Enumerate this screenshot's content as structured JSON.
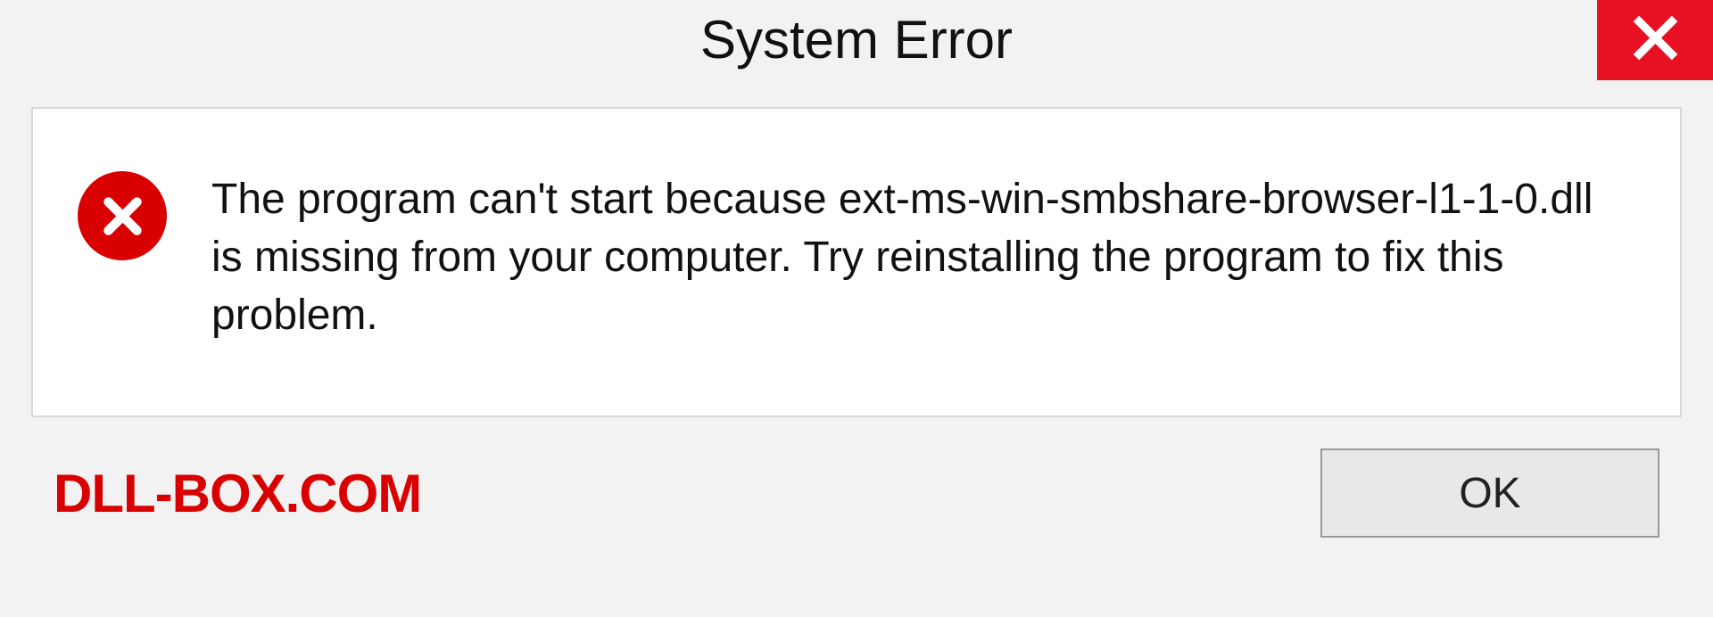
{
  "dialog": {
    "title": "System Error",
    "message": "The program can't start because ext-ms-win-smbshare-browser-l1-1-0.dll is missing from your computer. Try reinstalling the program to fix this problem.",
    "ok_label": "OK"
  },
  "watermark": "DLL-BOX.COM",
  "colors": {
    "close_bg": "#e81123",
    "error_icon": "#d80000",
    "watermark": "#d80000"
  }
}
